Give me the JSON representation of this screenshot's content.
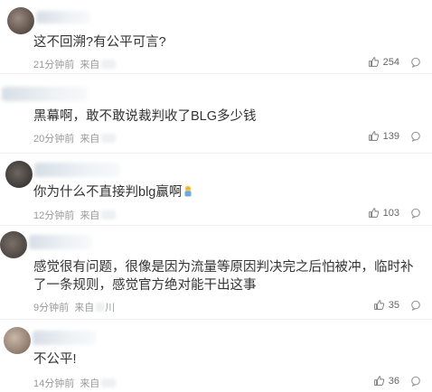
{
  "comments": [
    {
      "text": "这不回溯?有公平可言?",
      "time": "21分钟前",
      "source_prefix": "来自",
      "likes": "254"
    },
    {
      "text": "黑幕啊，敢不敢说裁判收了BLG多少钱",
      "time": "20分钟前",
      "source_prefix": "来自",
      "likes": "139"
    },
    {
      "text": "你为什么不直接判blg赢啊",
      "time": "12分钟前",
      "source_prefix": "来自",
      "likes": "103",
      "emoji": "facepalm-emoji"
    },
    {
      "text": "感觉很有问题，很像是因为流量等原因判决完之后怕被冲，临时补了一条规则，感觉官方绝对能干出这事",
      "time": "9分钟前",
      "source_prefix": "来自",
      "source_tail": "川",
      "likes": "35"
    },
    {
      "text": "不公平!",
      "time": "14分钟前",
      "source_prefix": "来自",
      "likes": "36"
    }
  ],
  "icons": {
    "like": "thumbs-up-icon",
    "reply": "comment-bubble-icon"
  },
  "colors": {
    "text": "#333333",
    "meta": "#999999",
    "divider": "#ededed"
  }
}
